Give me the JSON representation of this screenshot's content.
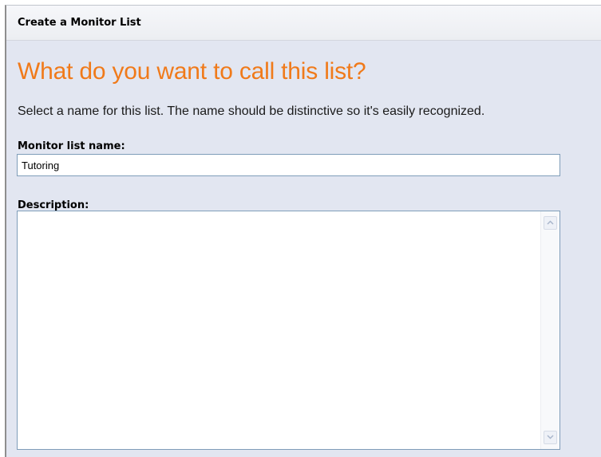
{
  "window": {
    "title": "Create a Monitor List"
  },
  "content": {
    "heading": "What do you want to call this list?",
    "instructions": "Select a name for this list. The name should be distinctive so it's easily recognized.",
    "name_label": "Monitor list name:",
    "name_value": "Tutoring",
    "description_label": "Description:",
    "description_value": ""
  },
  "icons": {
    "scroll_up": "chevron-up-icon",
    "scroll_down": "chevron-down-icon"
  },
  "colors": {
    "heading": "#f07a1a",
    "background": "#e2e6f1",
    "input_border": "#7f9db9"
  }
}
